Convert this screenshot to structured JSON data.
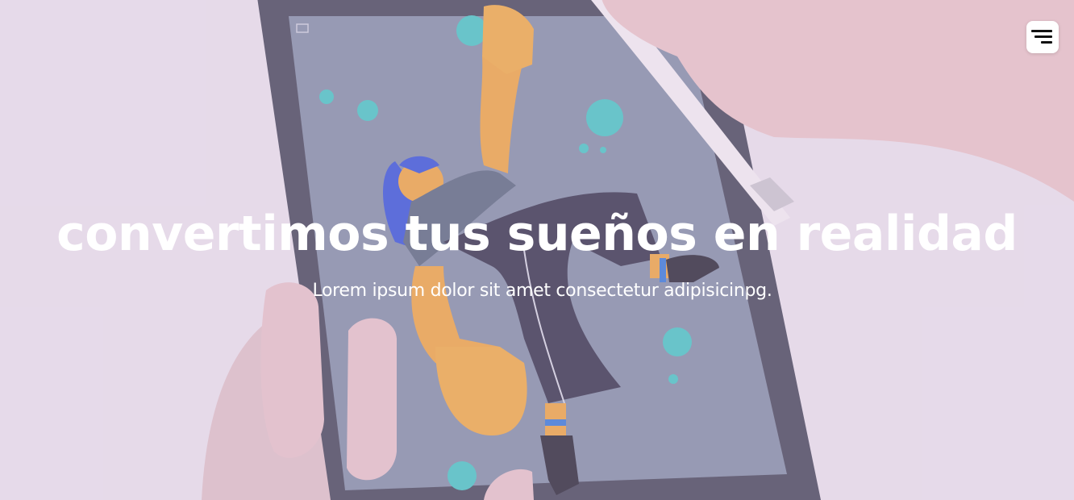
{
  "hero": {
    "title": "convertimos tus sueños en realidad",
    "subtitle": "Lorem ipsum dolor sit amet consectetur adipisicinpg.",
    "background_icon": "tablet-illustration-image",
    "overlay_color": "#d6bee0"
  },
  "header": {
    "menu_icon": "hamburger-menu-icon"
  }
}
